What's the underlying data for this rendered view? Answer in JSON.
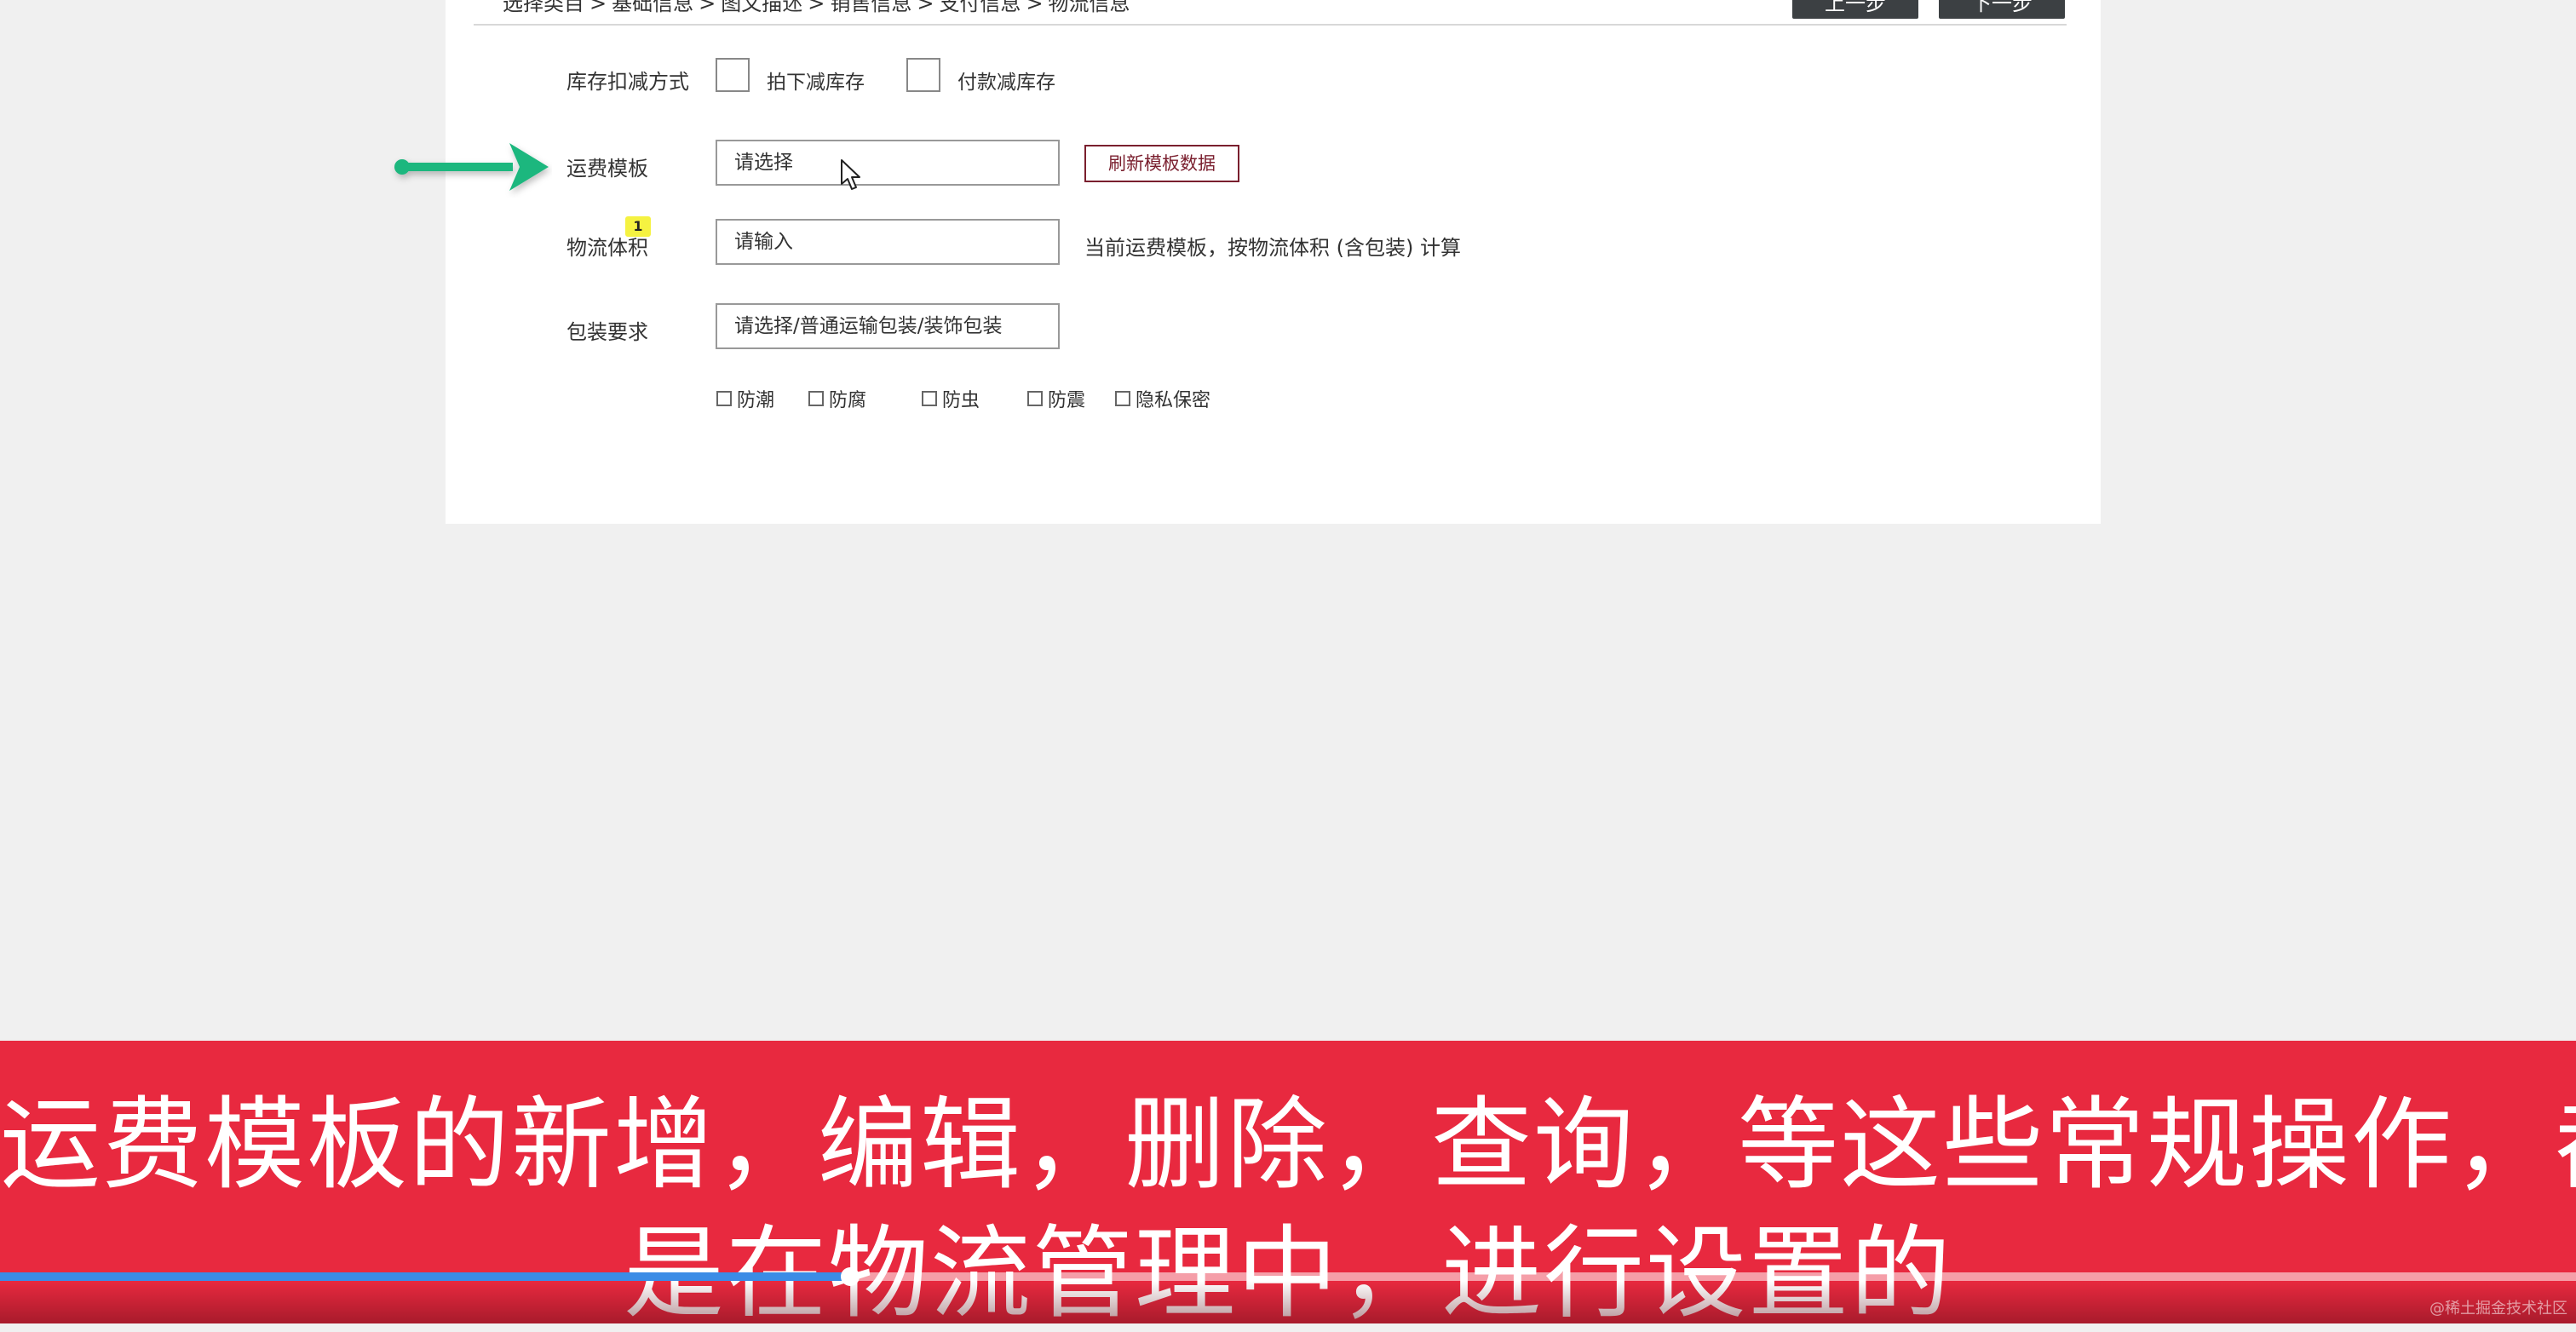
{
  "breadcrumb": {
    "items": [
      "选择类目",
      "基础信息",
      "图文描述",
      "销售信息",
      "支付信息",
      "物流信息"
    ],
    "separator": ">"
  },
  "nav": {
    "prev_label": "上一步",
    "next_label": "下一步"
  },
  "form": {
    "inventory": {
      "label": "库存扣减方式",
      "option1": "拍下减库存",
      "option2": "付款减库存"
    },
    "shipping_template": {
      "label": "运费模板",
      "placeholder": "请选择",
      "refresh_label": "刷新模板数据"
    },
    "volume": {
      "label": "物流体积",
      "placeholder": "请输入",
      "hint": "当前运费模板，按物流体积 (含包装) 计算",
      "badge": "1"
    },
    "packaging": {
      "label": "包装要求",
      "placeholder": "请选择/普通运输包装/装饰包装",
      "options": [
        "防潮",
        "防腐",
        "防虫",
        "防震",
        "隐私保密"
      ]
    }
  },
  "subtitle": {
    "line1": "运费模板的新增，编辑，删除，查询，等这些常规操作，都",
    "line2": "是在物流管理中，进行设置的"
  },
  "player": {
    "progress_fraction": 0.33
  },
  "watermark": "@稀土掘金技术社区",
  "colors": {
    "arrow": "#1fb77e",
    "subtitle_bg": "#e8293f",
    "progress": "#3b8ce6",
    "refresh_border": "#7a1f2e",
    "badge": "#f5f241"
  },
  "icons": {
    "arrow": "arrow-right-icon",
    "cursor": "mouse-cursor-icon"
  }
}
